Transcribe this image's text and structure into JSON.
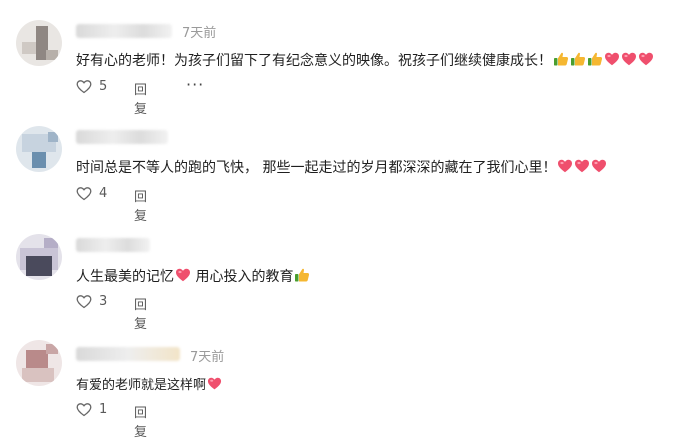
{
  "comments": [
    {
      "time": "7天前",
      "text": "好有心的老师！为孩子们留下了有纪念意义的映像。祝孩子们继续健康成长！",
      "emojis": [
        "thumb",
        "thumb",
        "thumb",
        "heart",
        "heart",
        "heart"
      ],
      "likes": "5",
      "reply": "回复",
      "more": "···"
    },
    {
      "time": "",
      "text": "时间总是不等人的跑的飞快， 那些一起走过的岁月都深深的藏在了我们心里！",
      "emojis": [
        "heart",
        "heart",
        "heart"
      ],
      "likes": "4",
      "reply": "回复"
    },
    {
      "time": "",
      "text": "人生最美的记忆",
      "text2": "用心投入的教育",
      "likes": "3",
      "reply": "回复"
    },
    {
      "time": "7天前",
      "text": "有爱的老师就是这样啊",
      "emojis": [
        "heart"
      ],
      "likes": "1",
      "reply": "回复"
    }
  ],
  "colors": {
    "heart": "#f0506e",
    "thumb": "#f2b632",
    "time": "#9a9a9a"
  }
}
